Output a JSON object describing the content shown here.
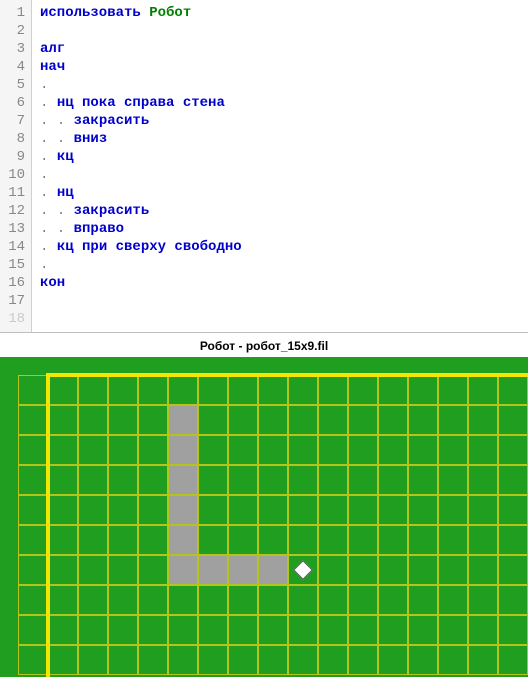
{
  "code": {
    "lines": [
      {
        "n": "1",
        "segs": [
          {
            "t": "использовать ",
            "c": "kw"
          },
          {
            "t": "Робот",
            "c": "id"
          }
        ]
      },
      {
        "n": "2",
        "segs": []
      },
      {
        "n": "3",
        "segs": [
          {
            "t": "алг",
            "c": "kw"
          }
        ]
      },
      {
        "n": "4",
        "segs": [
          {
            "t": "нач",
            "c": "kw"
          }
        ]
      },
      {
        "n": "5",
        "segs": [
          {
            "t": ".",
            "c": "dot"
          }
        ]
      },
      {
        "n": "6",
        "segs": [
          {
            "t": ". ",
            "c": "dot"
          },
          {
            "t": "нц пока ",
            "c": "kw"
          },
          {
            "t": "справа стена",
            "c": "kw"
          }
        ]
      },
      {
        "n": "7",
        "segs": [
          {
            "t": ". . ",
            "c": "dot"
          },
          {
            "t": "закрасить",
            "c": "kw"
          }
        ]
      },
      {
        "n": "8",
        "segs": [
          {
            "t": ". . ",
            "c": "dot"
          },
          {
            "t": "вниз",
            "c": "kw"
          }
        ]
      },
      {
        "n": "9",
        "segs": [
          {
            "t": ". ",
            "c": "dot"
          },
          {
            "t": "кц",
            "c": "kw"
          }
        ]
      },
      {
        "n": "10",
        "segs": [
          {
            "t": ".",
            "c": "dot"
          }
        ]
      },
      {
        "n": "11",
        "segs": [
          {
            "t": ". ",
            "c": "dot"
          },
          {
            "t": "нц",
            "c": "kw"
          }
        ]
      },
      {
        "n": "12",
        "segs": [
          {
            "t": ". . ",
            "c": "dot"
          },
          {
            "t": "закрасить",
            "c": "kw"
          }
        ]
      },
      {
        "n": "13",
        "segs": [
          {
            "t": ". . ",
            "c": "dot"
          },
          {
            "t": "вправо",
            "c": "kw"
          }
        ]
      },
      {
        "n": "14",
        "segs": [
          {
            "t": ". ",
            "c": "dot"
          },
          {
            "t": "кц при ",
            "c": "kw"
          },
          {
            "t": "сверху свободно",
            "c": "kw"
          }
        ]
      },
      {
        "n": "15",
        "segs": [
          {
            "t": ".",
            "c": "dot"
          }
        ]
      },
      {
        "n": "16",
        "segs": [
          {
            "t": "кон",
            "c": "kw"
          }
        ]
      },
      {
        "n": "17",
        "segs": []
      },
      {
        "n": "18",
        "segs": [],
        "dim": true
      }
    ]
  },
  "sim": {
    "title": "Робот - робот_15x9.fil",
    "cell_size": 30,
    "cols": 17,
    "rows": 10,
    "painted_cells": [
      {
        "col": 5,
        "row": 1
      },
      {
        "col": 5,
        "row": 2
      },
      {
        "col": 5,
        "row": 3
      },
      {
        "col": 5,
        "row": 4
      },
      {
        "col": 5,
        "row": 5
      },
      {
        "col": 5,
        "row": 6
      },
      {
        "col": 6,
        "row": 6
      },
      {
        "col": 7,
        "row": 6
      },
      {
        "col": 8,
        "row": 6
      }
    ],
    "robot": {
      "col": 9,
      "row": 6
    },
    "walls": {
      "top": {
        "from_col": 1,
        "to_col": 17,
        "row": 0
      },
      "left": {
        "col": 1,
        "from_row": 0,
        "to_row": 10
      }
    }
  }
}
